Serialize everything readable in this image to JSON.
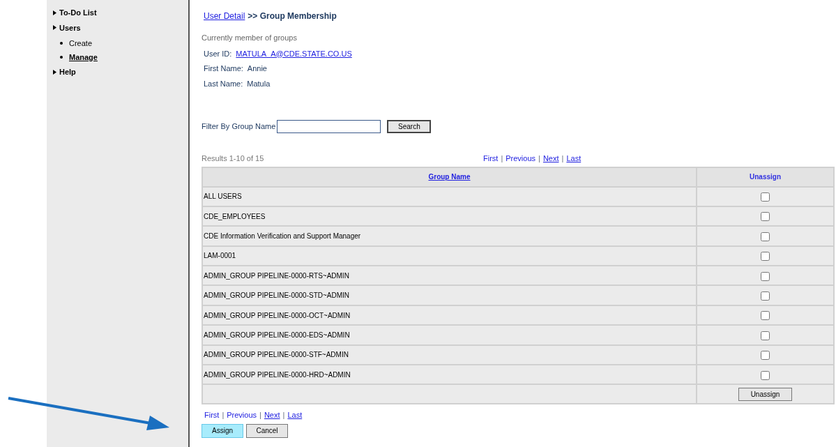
{
  "sidebar": {
    "sections": [
      {
        "label": "To-Do List"
      },
      {
        "label": "Users",
        "children": [
          {
            "label": "Create",
            "selected": false
          },
          {
            "label": "Manage",
            "selected": true
          }
        ]
      },
      {
        "label": "Help"
      }
    ]
  },
  "breadcrumb": {
    "link": "User Detail",
    "separator": ">>",
    "current": "Group Membership"
  },
  "heading": "Currently member of groups",
  "user": [
    {
      "label": "User ID:",
      "value": "MATULA_A@CDE.STATE.CO.US",
      "kind": "link"
    },
    {
      "label": "First Name:",
      "value": "Annie",
      "kind": "text"
    },
    {
      "label": "Last Name:",
      "value": "Matula",
      "kind": "text"
    }
  ],
  "filter": {
    "label": "Filter By Group Name",
    "button": "Search"
  },
  "results": "Results 1-10 of 15",
  "pager_top": {
    "separators": [
      "|",
      "|",
      "|"
    ],
    "links": [
      {
        "label": "First",
        "underlined": false
      },
      {
        "label": "Previous",
        "underlined": false
      },
      {
        "label": "Next",
        "underlined": true
      },
      {
        "label": "Last",
        "underlined": true
      }
    ]
  },
  "table": {
    "columns": [
      "Group Name",
      "Unassign"
    ],
    "rows": [
      {
        "name": "ALL USERS",
        "checked": false
      },
      {
        "name": "CDE_EMPLOYEES",
        "checked": false
      },
      {
        "name": "CDE Information Verification and Support Manager",
        "checked": false
      },
      {
        "name": "LAM-0001",
        "checked": false
      },
      {
        "name": "ADMIN_GROUP PIPELINE-0000-RTS~ADMIN",
        "checked": false
      },
      {
        "name": "ADMIN_GROUP PIPELINE-0000-STD~ADMIN",
        "checked": false
      },
      {
        "name": "ADMIN_GROUP PIPELINE-0000-OCT~ADMIN",
        "checked": false
      },
      {
        "name": "ADMIN_GROUP PIPELINE-0000-EDS~ADMIN",
        "checked": false
      },
      {
        "name": "ADMIN_GROUP PIPELINE-0000-STF~ADMIN",
        "checked": false
      },
      {
        "name": "ADMIN_GROUP PIPELINE-0000-HRD~ADMIN",
        "checked": false
      }
    ],
    "footer_button": "Unassign"
  },
  "pager_bottom": {
    "separators": [
      "|",
      "|",
      "|"
    ],
    "links": [
      {
        "label": "First",
        "underlined": false
      },
      {
        "label": "Previous",
        "underlined": false
      },
      {
        "label": "Next",
        "underlined": true
      },
      {
        "label": "Last",
        "underlined": true
      }
    ]
  },
  "buttons": [
    {
      "label": "Assign",
      "kind": "primary"
    },
    {
      "label": "Cancel",
      "kind": "secondary"
    }
  ]
}
